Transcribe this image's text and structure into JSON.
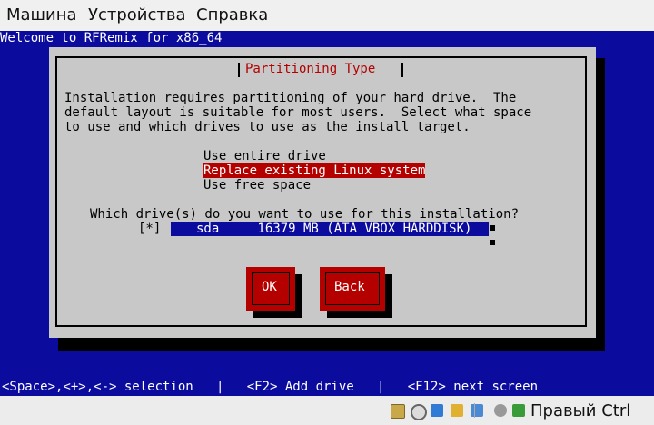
{
  "menubar": {
    "items": [
      "Машина",
      "Устройства",
      "Справка"
    ]
  },
  "screen": {
    "welcome": "Welcome to RFRemix for x86_64",
    "dialog": {
      "title": "Partitioning Type",
      "description": "Installation requires partitioning of your hard drive.  The\ndefault layout is suitable for most users.  Select what space\nto use and which drives to use as the install target.",
      "options": [
        {
          "label": "Use entire drive",
          "selected": false
        },
        {
          "label": "Replace existing Linux system",
          "selected": true
        },
        {
          "label": "Use free space",
          "selected": false
        }
      ],
      "question": "Which drive(s) do you want to use for this installation?",
      "drive": {
        "checkbox": "[*]",
        "label": "sda     16379 MB (ATA VBOX HARDDISK)"
      },
      "buttons": {
        "ok": "OK",
        "back": "Back"
      }
    },
    "hint": "<Space>,<+>,<-> selection   |   <F2> Add drive   |   <F12> next screen"
  },
  "statusbar": {
    "host_key": "Правый Ctrl",
    "icons": [
      "hard-disk-icon",
      "optical-disk-icon",
      "usb-icon",
      "shared-folder-icon",
      "display-icon",
      "video-capture-icon",
      "mouse-integration-icon",
      "host-key-arrow-icon"
    ],
    "colors": {
      "accent": "#0b0b9e",
      "selection": "#b50000"
    }
  }
}
